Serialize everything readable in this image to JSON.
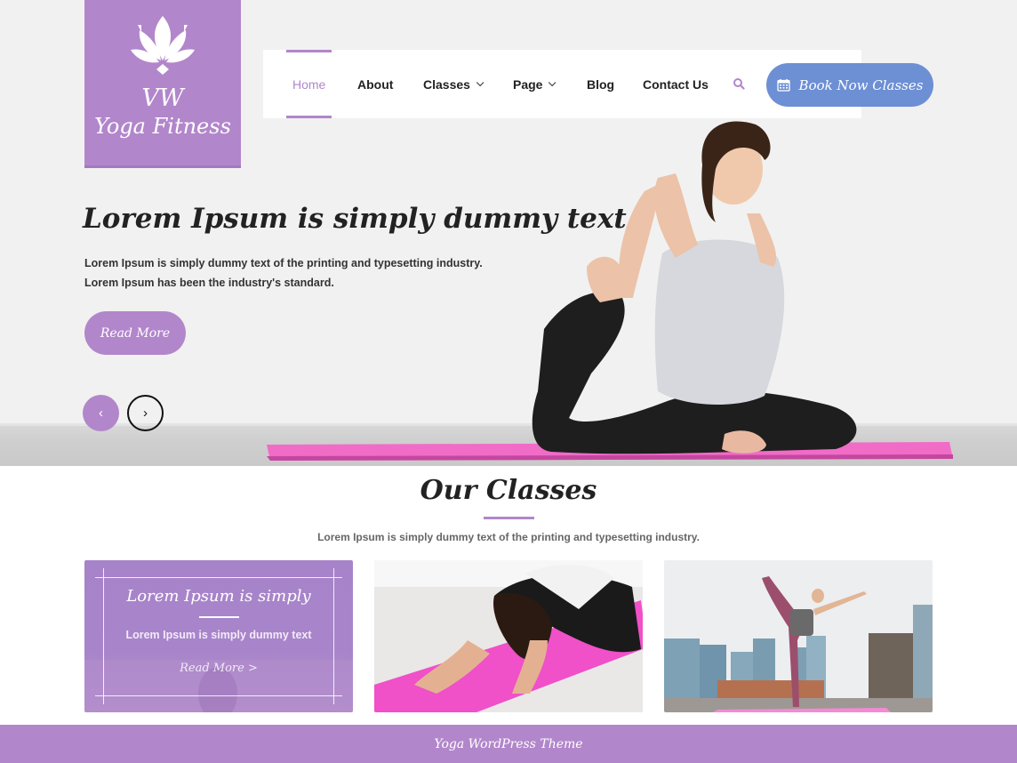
{
  "brand": {
    "line1": "VW",
    "line2": "Yoga Fitness",
    "icon": "lotus-icon",
    "color": "#b286cb"
  },
  "nav": {
    "items": [
      {
        "label": "Home",
        "active": true,
        "has_dropdown": false
      },
      {
        "label": "About",
        "active": false,
        "has_dropdown": false
      },
      {
        "label": "Classes",
        "active": false,
        "has_dropdown": true
      },
      {
        "label": "Page",
        "active": false,
        "has_dropdown": true
      },
      {
        "label": "Blog",
        "active": false,
        "has_dropdown": false
      },
      {
        "label": "Contact Us",
        "active": false,
        "has_dropdown": false
      }
    ],
    "search_icon": "search-icon",
    "book_button": {
      "label": "Book Now Classes",
      "icon": "calendar-icon",
      "color": "#6d8fd4"
    }
  },
  "hero": {
    "title": "Lorem Ipsum is simply dummy text",
    "desc_line1": "Lorem Ipsum is simply dummy text of the printing and typesetting industry.",
    "desc_line2": "Lorem Ipsum has been the industry's standard.",
    "read_more": "Read More",
    "prev_glyph": "‹",
    "next_glyph": "›"
  },
  "classes": {
    "title": "Our Classes",
    "description": "Lorem Ipsum is simply dummy text of the printing and typesetting industry.",
    "cards": [
      {
        "type": "overlay",
        "title": "Lorem Ipsum is simply",
        "text": "Lorem Ipsum is simply dummy text",
        "link": "Read More >"
      },
      {
        "type": "image",
        "alt": "woman in child's pose on pink mat"
      },
      {
        "type": "image",
        "alt": "woman in dancer pose on rooftop with city skyline"
      }
    ]
  },
  "footer": {
    "text": "Yoga WordPress Theme"
  }
}
